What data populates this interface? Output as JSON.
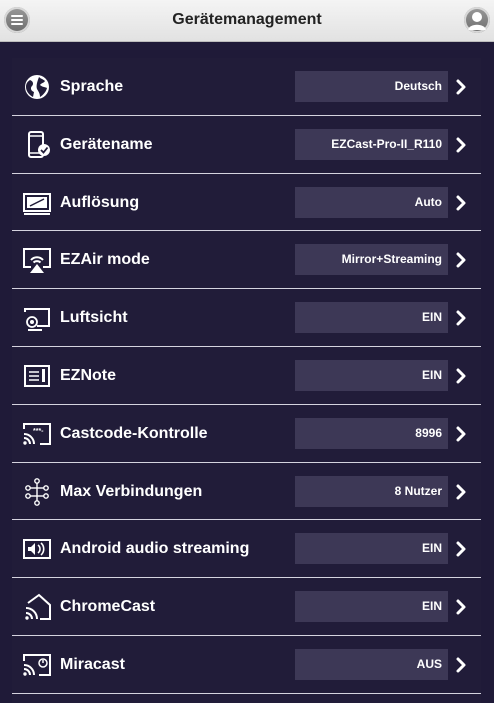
{
  "header": {
    "title": "Gerätemanagement",
    "menu_icon": "hamburger-menu-icon",
    "user_icon": "user-avatar-icon"
  },
  "settings": [
    {
      "label": "Sprache",
      "value": "Deutsch",
      "icon": "globe-icon"
    },
    {
      "label": "Gerätename",
      "value": "EZCast-Pro-II_R110",
      "icon": "device-check-icon"
    },
    {
      "label": "Auflösung",
      "value": "Auto",
      "icon": "monitor-icon"
    },
    {
      "label": "EZAir mode",
      "value": "Mirror+Streaming",
      "icon": "airplay-icon"
    },
    {
      "label": "Luftsicht",
      "value": "EIN",
      "icon": "airview-icon"
    },
    {
      "label": "EZNote",
      "value": "EIN",
      "icon": "note-icon"
    },
    {
      "label": "Castcode-Kontrolle",
      "value": "8996",
      "icon": "castcode-icon"
    },
    {
      "label": "Max Verbindungen",
      "value": "8 Nutzer",
      "icon": "connections-icon"
    },
    {
      "label": "Android audio streaming",
      "value": "EIN",
      "icon": "audio-stream-icon"
    },
    {
      "label": "ChromeCast",
      "value": "EIN",
      "icon": "chromecast-icon"
    },
    {
      "label": "Miracast",
      "value": "AUS",
      "icon": "miracast-icon"
    }
  ],
  "colors": {
    "background": "#1f1a38",
    "value_box": "#3d3856",
    "divider": "#d5d3df"
  }
}
